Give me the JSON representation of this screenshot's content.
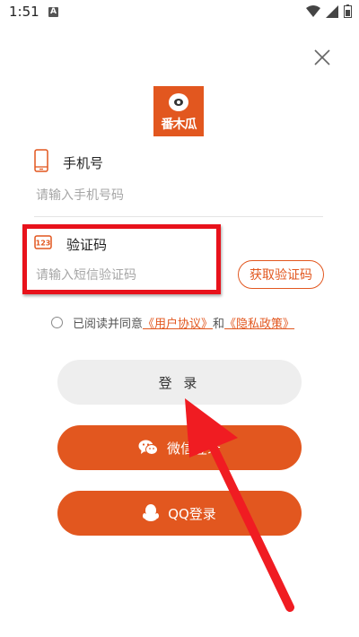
{
  "status_bar": {
    "time": "1:51",
    "notification_letter": "A"
  },
  "app": {
    "logo_text": "番木瓜",
    "brand_color": "#e2571f"
  },
  "phone": {
    "label": "手机号",
    "placeholder": "请输入手机号码",
    "icon": "phone-icon"
  },
  "code": {
    "label": "验证码",
    "placeholder": "请输入短信验证码",
    "icon": "keypad-123-icon",
    "get_code_button": "获取验证码"
  },
  "agreement": {
    "prefix": "已阅读并同意",
    "user_agreement": "《用户协议》",
    "conjunction": "和",
    "privacy_policy": "《隐私政策》"
  },
  "buttons": {
    "login": "登 录",
    "wechat_login": "微信登录",
    "qq_login": "QQ登录"
  },
  "annotation": {
    "highlight_color": "#e8121b"
  }
}
